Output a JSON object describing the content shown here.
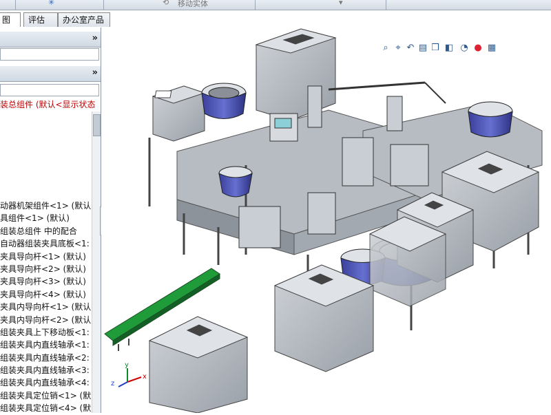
{
  "toolbar": {
    "move_entity_label": "移动实体"
  },
  "tabs": [
    {
      "label": "图"
    },
    {
      "label": "评估"
    },
    {
      "label": "办公室产品"
    }
  ],
  "panel": {
    "root_item": "装总组件 (默认<显示状态",
    "items": [
      "动器机架组件<1> (默认)",
      "具组件<1> (默认)",
      "组装总组件 中的配合",
      "自动器组装夹具底板<1:",
      "夹具导向杆<1> (默认)",
      "夹具导向杆<2> (默认)",
      "夹具导向杆<3> (默认)",
      "夹具导向杆<4> (默认)",
      "夹具内导向杆<1> (默认",
      "夹具内导向杆<2> (默认",
      "组装夹具上下移动板<1:",
      "组装夹具内直线轴承<1:",
      "组装夹具内直线轴承<2:",
      "组装夹具内直线轴承<3:",
      "组装夹具内直线轴承<4:",
      "组装夹具定位销<1> (默",
      "组装夹具定位销<4> (默"
    ]
  },
  "colors": {
    "frame": "#b8bec6",
    "frame_dark": "#6e747c",
    "bowl_blue": "#4a55b0",
    "conveyor_green": "#1f9b3a",
    "tree_root_red": "#c00000"
  },
  "view_tools": [
    "zoom-fit-icon",
    "zoom-area-icon",
    "previous-view-icon",
    "section-view-icon",
    "view-orientation-icon",
    "display-style-icon",
    "hide-show-icon",
    "appearance-icon",
    "scene-icon"
  ],
  "axes": {
    "x": "x",
    "y": "y",
    "z": "z"
  }
}
